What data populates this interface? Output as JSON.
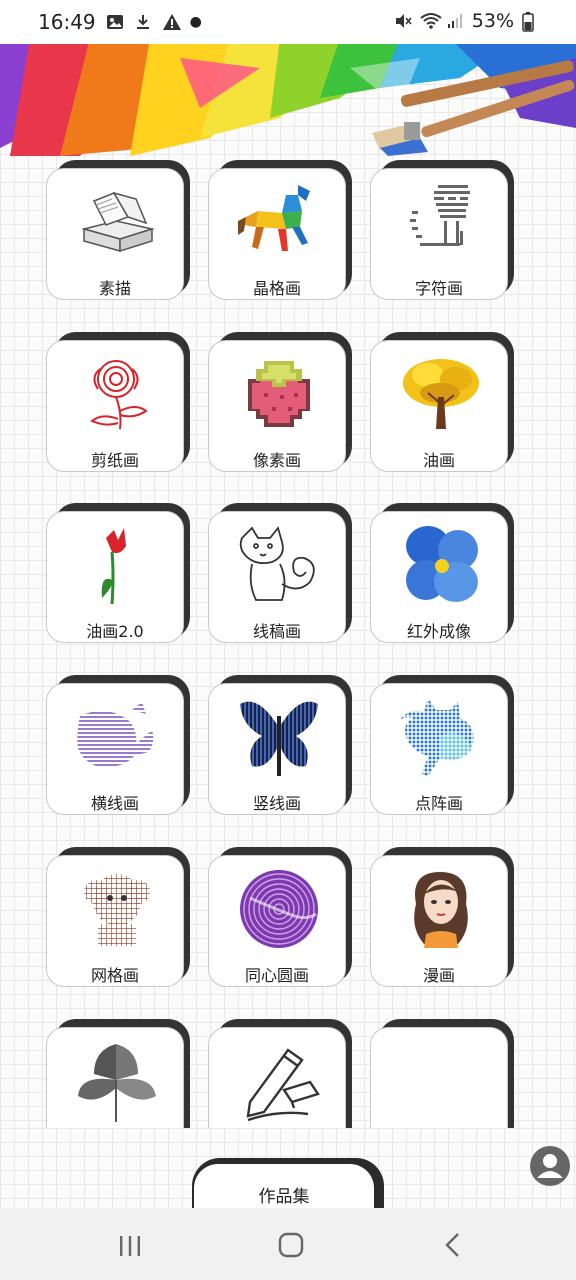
{
  "status_bar": {
    "time": "16:49",
    "battery": "53%"
  },
  "grid": {
    "items": [
      {
        "label": "素描",
        "icon": "books-sketch-icon"
      },
      {
        "label": "晶格画",
        "icon": "lowpoly-horse-icon"
      },
      {
        "label": "字符画",
        "icon": "ascii-cat-icon"
      },
      {
        "label": "剪纸画",
        "icon": "papercut-flower-icon"
      },
      {
        "label": "像素画",
        "icon": "pixel-strawberry-icon"
      },
      {
        "label": "油画",
        "icon": "oil-tree-icon"
      },
      {
        "label": "油画2.0",
        "icon": "tulip-icon"
      },
      {
        "label": "线稿画",
        "icon": "lineart-squirrel-icon"
      },
      {
        "label": "红外成像",
        "icon": "blue-flower-icon"
      },
      {
        "label": "横线画",
        "icon": "horizontal-lines-whale-icon"
      },
      {
        "label": "竖线画",
        "icon": "vertical-lines-butterfly-icon"
      },
      {
        "label": "点阵画",
        "icon": "dot-matrix-cat-icon"
      },
      {
        "label": "网格画",
        "icon": "grid-monkey-icon"
      },
      {
        "label": "同心圆画",
        "icon": "concentric-circles-icon"
      },
      {
        "label": "漫画",
        "icon": "manga-girl-icon"
      },
      {
        "label": "",
        "icon": "ginkgo-leaves-icon"
      },
      {
        "label": "",
        "icon": "pencil-eraser-icon"
      },
      {
        "label": "",
        "icon": ""
      }
    ]
  },
  "bottom": {
    "works_label": "作品集"
  },
  "colors": {
    "card_shadow": "#333333",
    "tab_shadow": "#2b2b2b",
    "profile": "#666666"
  }
}
